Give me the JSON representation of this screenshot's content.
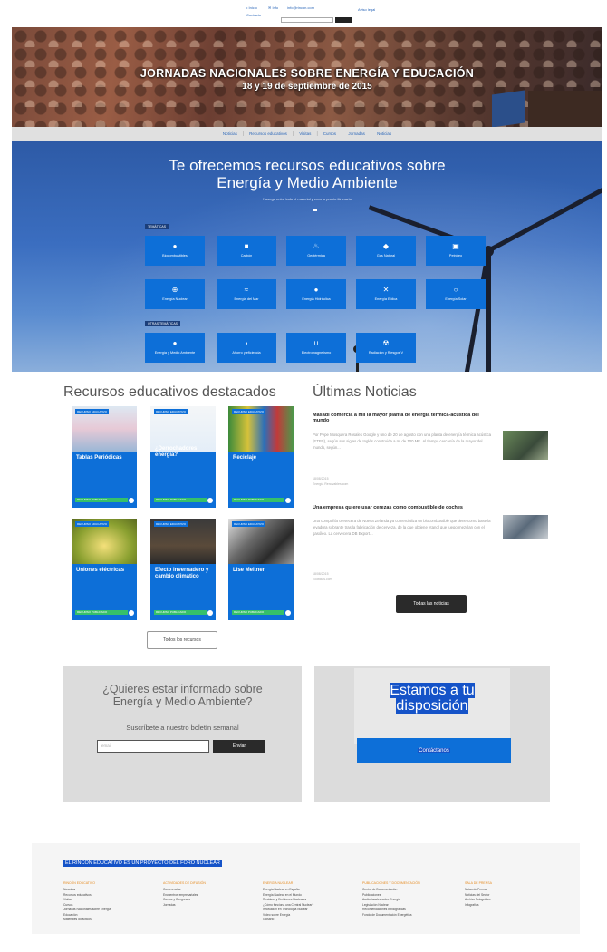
{
  "topbar": {
    "lang_es": "• Inicio",
    "lang_en": "✉ Info",
    "mail": "info@rincon.com",
    "extra": "Contacto",
    "links": "Aviso legal"
  },
  "hero": {
    "title": "JORNADAS NACIONALES SOBRE ENERGÍA Y EDUCACIÓN",
    "subtitle": "18 y 19 de septiembre de 2015"
  },
  "nav": {
    "items": [
      "Noticias",
      "Recursos educativos",
      "Visitas",
      "Cursos",
      "Jornadas",
      "Noticias"
    ]
  },
  "intro": {
    "title_line1": "Te ofrecemos recursos educativos sobre",
    "title_line2": "Energía y Medio Ambiente",
    "subtitle": "Navega entre todo el material y crea tu propio itinerario",
    "group1": "TEMÁTICAS",
    "group2": "OTRAS TEMÁTICAS",
    "tiles_row1": [
      "Biocombustibles",
      "Carbón",
      "Geotérmica",
      "Gas Natural",
      "Petróleo"
    ],
    "tiles_row2": [
      "Energía Nuclear",
      "Energía del Mar",
      "Energía Hidráulica",
      "Energía Eólica",
      "Energía Solar"
    ],
    "tiles_row3": [
      "Energía y Medio Ambiente",
      "Ahorro y eficiencia",
      "Electromagnetismo",
      "Radiación y Riesgos V"
    ]
  },
  "resources": {
    "title": "Recursos educativos destacados",
    "cards": [
      {
        "tag": "RECURSO EDUCATIVO",
        "title": "Tablas Periódicas",
        "btn": "RECURSO PUBLICADO"
      },
      {
        "tag": "RECURSO EDUCATIVO",
        "title": "¿Derrochadores energía?",
        "btn": "RECURSO PUBLICADO"
      },
      {
        "tag": "RECURSO EDUCATIVO",
        "title": "Reciclaje",
        "btn": "RECURSO PUBLICADO"
      },
      {
        "tag": "RECURSO EDUCATIVO",
        "title": "Uniones eléctricas",
        "btn": "RECURSO PUBLICADO"
      },
      {
        "tag": "RECURSO EDUCATIVO",
        "title": "Efecto invernadero y cambio climático",
        "btn": "RECURSO PUBLICADO"
      },
      {
        "tag": "RECURSO EDUCATIVO",
        "title": "Lise Meitner",
        "btn": "RECURSO PUBLICADO"
      }
    ],
    "all_button": "Todos los recursos"
  },
  "news": {
    "title": "Últimas Noticias",
    "items": [
      {
        "headline": "Masadi comercia a mil la mayor planta de energía térmica-acústica del mundo",
        "body": "Por Pepe Mosquera Rosales Google y uno de 20 de agosto con una planta de energía térmica acústica (ETPS), según sus siglas de Inglés construida a ml de 100 ME. Al tiempo cercanía de la mayor del mundo, según...",
        "date": "18/08/2015",
        "source": "Energía Renovables.com"
      },
      {
        "headline": "Una empresa quiere usar cerezas como combustible de coches",
        "body": "Una compañía cervecera de Nueva Zelanda ya comercializa un biocombustible que tiene como base la levadura sobrante tras la fabricación de cerveza, de la que obtiene etanol que luego mezclan con el gasóleo. La cervecera DB Export...",
        "date": "18/08/2015",
        "source": "Ecoticias.com"
      }
    ],
    "all_button": "Todas las noticias"
  },
  "newsletter": {
    "question_line1": "¿Quieres estar informado sobre",
    "question_line2": "Energía y Medio Ambiente?",
    "subtitle": "Suscríbete a nuestro boletín semanal",
    "placeholder": "email",
    "button": "Enviar"
  },
  "contact": {
    "title_line1": "Estamos a tu",
    "title_line2": "disposición",
    "button": "Contáctanos"
  },
  "footer": {
    "heading": "EL RINCÓN EDUCATIVO ES UN PROYECTO DEL FORO NUCLEAR",
    "columns": [
      {
        "title": "RINCÓN EDUCATIVO",
        "links": [
          "Nosotros",
          "Recursos educativos",
          "Visitas",
          "Cursos",
          "Jornadas Nacionales sobre Energía",
          "Educación",
          "Materiales didácticos"
        ]
      },
      {
        "title": "ACTIVIDADES DE DIFUSIÓN",
        "links": [
          "Conferencias",
          "Encuentros empresariales",
          "Cursos y Congresos",
          "Jornadas"
        ]
      },
      {
        "title": "ENERGÍA NUCLEAR",
        "links": [
          "Energía Nuclear en España",
          "Energía Nuclear en el Mundo",
          "Residuos y Emisiones Nucleares",
          "¿Cómo funciona una Central Nuclear?",
          "Innovación en Tecnología Nuclear",
          "Vídeo sobre Energía",
          "Glosario"
        ]
      },
      {
        "title": "PUBLICACIONES Y DOCUMENTACIÓN",
        "links": [
          "Centro de Documentación",
          "Publicaciones",
          "Audiovisuales sobre Energía",
          "Legislación Nuclear",
          "Recomendaciones Bibliográficas",
          "Fondo de Documentación Energética"
        ]
      },
      {
        "title": "SALA DE PRENSA",
        "links": [
          "Notas de Prensa",
          "Noticias del Sector",
          "Archivo Fotográfico",
          "Infografías"
        ]
      }
    ]
  },
  "colors": {
    "accent_blue": "#0d6fd8",
    "green": "#36c06a",
    "footer_orange": "#e58a1f"
  }
}
